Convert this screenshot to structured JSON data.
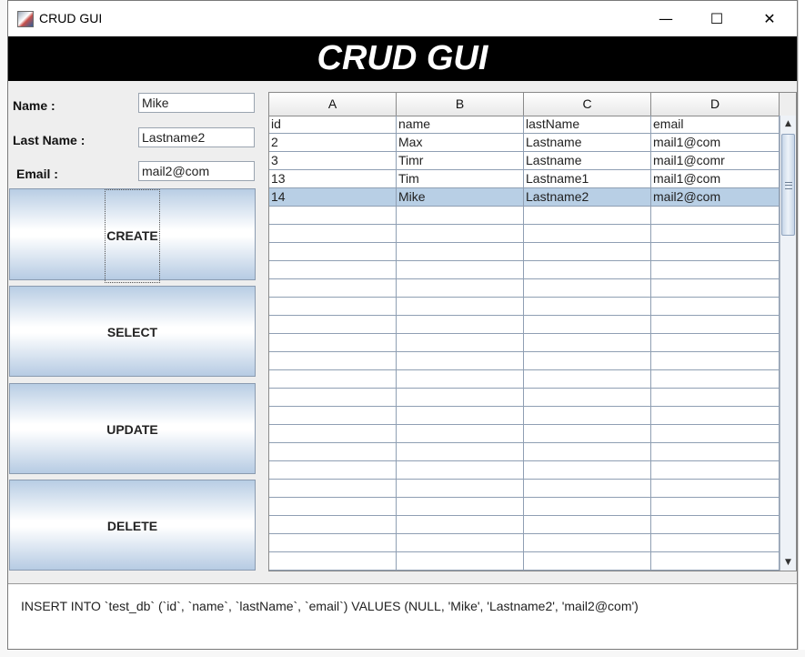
{
  "window": {
    "title": "CRUD GUI",
    "minimize_glyph": "—",
    "maximize_glyph": "☐",
    "close_glyph": "✕"
  },
  "banner": {
    "title": "CRUD GUI"
  },
  "form": {
    "name_label": "Name :",
    "name_value": "Mike",
    "lastname_label": "Last Name :",
    "lastname_value": "Lastname2",
    "email_label": "Email :",
    "email_value": "mail2@com"
  },
  "buttons": {
    "create": "CREATE",
    "select": "SELECT",
    "update": "UPDATE",
    "delete": "DELETE"
  },
  "table": {
    "column_headers": [
      "A",
      "B",
      "C",
      "D"
    ],
    "rows": [
      [
        "id",
        "name",
        "lastName",
        "email"
      ],
      [
        "2",
        "Max",
        "Lastname",
        "mail1@com"
      ],
      [
        "3",
        "Timr",
        "Lastname",
        "mail1@comr"
      ],
      [
        "13",
        "Tim",
        "Lastname1",
        "mail1@com"
      ],
      [
        "14",
        "Mike",
        "Lastname2",
        "mail2@com"
      ]
    ],
    "selected_row_index": 4,
    "total_visible_rows": 25,
    "selection_color": "#b8cfe5"
  },
  "scrollbar": {
    "up_glyph": "▲",
    "down_glyph": "▼"
  },
  "output": {
    "sql": "INSERT INTO `test_db` (`id`, `name`, `lastName`, `email`) VALUES (NULL, 'Mike', 'Lastname2', 'mail2@com')"
  },
  "colors": {
    "banner_bg": "#000000",
    "banner_text": "#ffffff",
    "button_gradient_edge": "#b8cde4"
  },
  "icons": {
    "app": "java-app-icon",
    "minimize": "minimize-icon",
    "maximize": "maximize-icon",
    "close": "close-icon"
  }
}
